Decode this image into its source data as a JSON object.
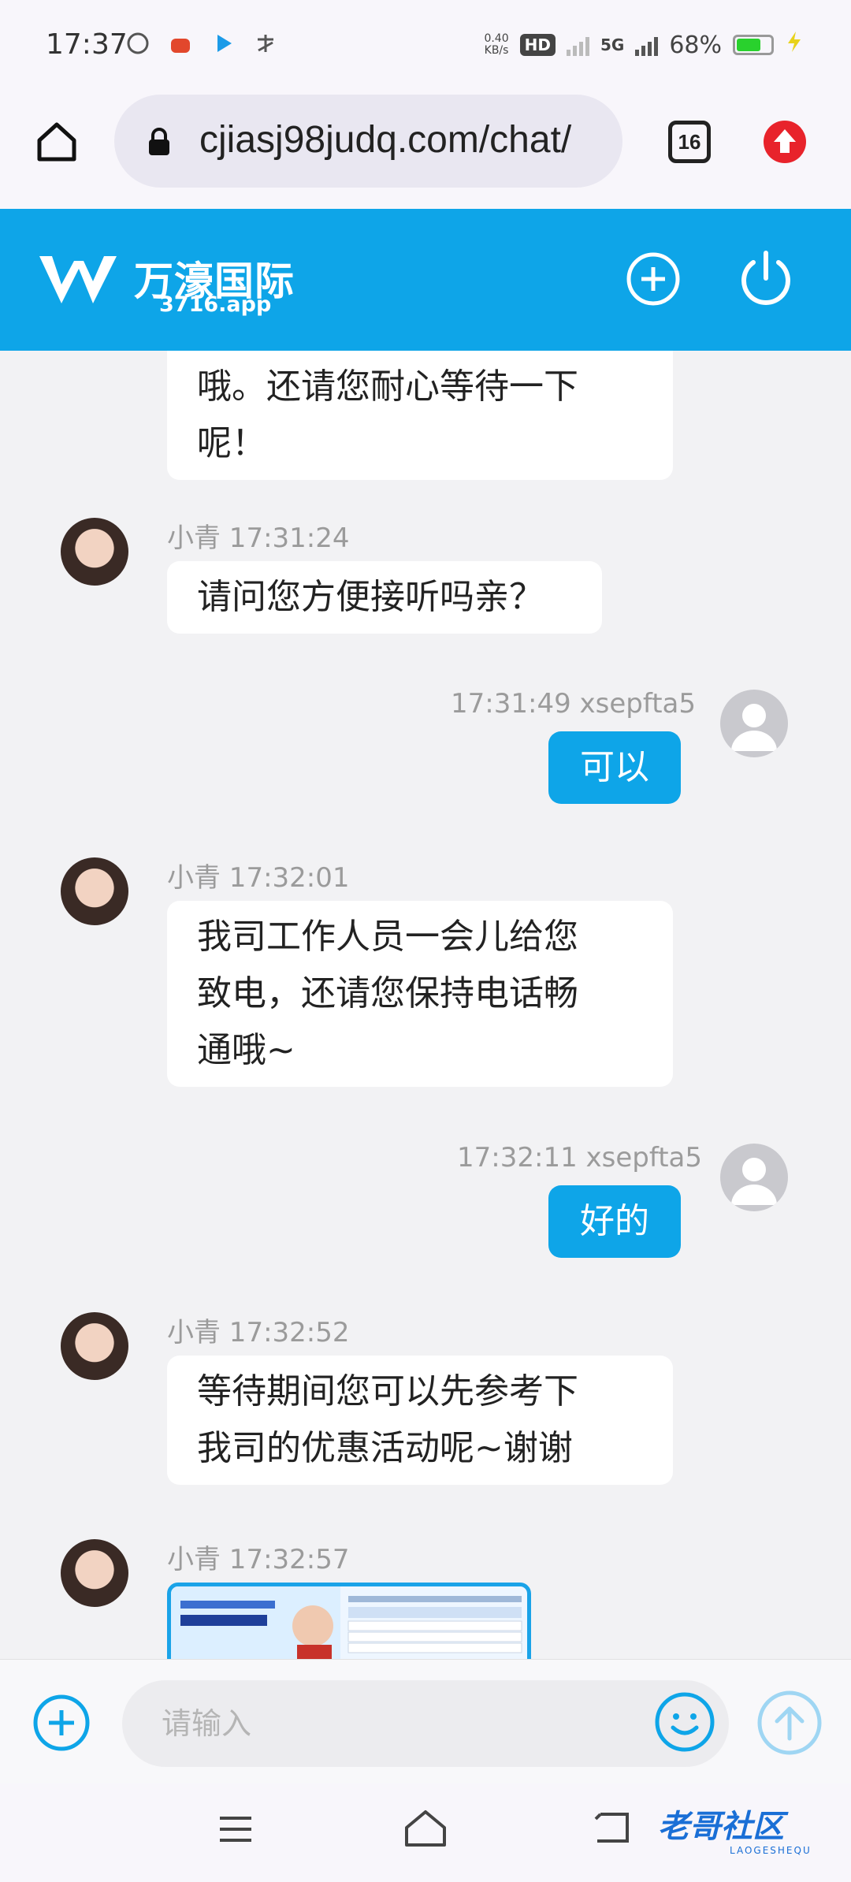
{
  "status_bar": {
    "time": "17:37",
    "net_speed_value": "0.40",
    "net_speed_unit": "KB/s",
    "hd": "HD",
    "network": "5G",
    "battery": "68%",
    "battery_level": 0.68
  },
  "browser": {
    "url": "cjiasj98judq.com/chat/",
    "tab_count": "16"
  },
  "app": {
    "brand": "万濠国际",
    "domain": "3716.app"
  },
  "messages": [
    {
      "from": "agent",
      "text_lines": [
        "哦。还请您耐心等待一下",
        "呢！"
      ]
    },
    {
      "from": "agent",
      "meta": "小青 17:31:24",
      "text_lines": [
        "请问您方便接听吗亲？"
      ]
    },
    {
      "from": "user",
      "meta": "17:31:49 xsepfta5",
      "text_lines": [
        "可以"
      ]
    },
    {
      "from": "agent",
      "meta": "小青 17:32:01",
      "text_lines": [
        "我司工作人员一会儿给您",
        "致电，还请您保持电话畅",
        "通哦~"
      ]
    },
    {
      "from": "user",
      "meta": "17:32:11 xsepfta5",
      "text_lines": [
        "好的"
      ]
    },
    {
      "from": "agent",
      "meta": "小青 17:32:52",
      "text_lines": [
        "等待期间您可以先参考下",
        "我司的优惠活动呢~谢谢"
      ]
    },
    {
      "from": "agent",
      "meta": "小青 17:32:57"
    }
  ],
  "input": {
    "placeholder": "请输入"
  },
  "watermark": {
    "title": "老哥社区",
    "sub": "LAOGESHEQU"
  },
  "colors": {
    "accent": "#0ea5e8",
    "background": "#f2f2f4"
  }
}
